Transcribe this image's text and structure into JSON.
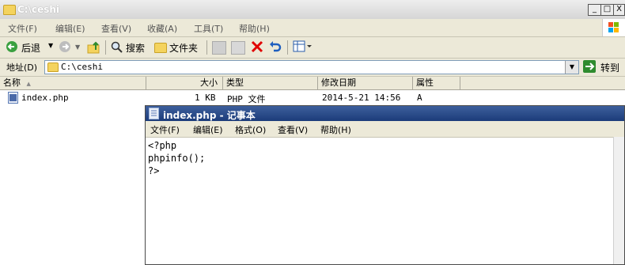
{
  "explorer": {
    "title": "C:\\ceshi",
    "window_controls": {
      "minimize": "_",
      "maximize": "□",
      "close": "X"
    },
    "menu": [
      "文件(F)",
      "编辑(E)",
      "查看(V)",
      "收藏(A)",
      "工具(T)",
      "帮助(H)"
    ],
    "toolbar": {
      "back": "后退",
      "search": "搜索",
      "folders": "文件夹"
    },
    "address": {
      "label": "地址(D)",
      "value": "C:\\ceshi",
      "go": "转到"
    },
    "columns": [
      "名称",
      "大小",
      "类型",
      "修改日期",
      "属性"
    ],
    "files": [
      {
        "name": "index.php",
        "size": "1 KB",
        "type": "PHP 文件",
        "modified": "2014-5-21 14:56",
        "attr": "A"
      }
    ]
  },
  "notepad": {
    "title": "index.php - 记事本",
    "menu": [
      "文件(F)",
      "编辑(E)",
      "格式(O)",
      "查看(V)",
      "帮助(H)"
    ],
    "content": "<?php\nphpinfo();\n?>"
  },
  "colors": {
    "menu_bg": "#ece9d8",
    "notepad_title": "#1c3c7a",
    "close_red": "#e00000",
    "go_green": "#2e8b2e"
  }
}
